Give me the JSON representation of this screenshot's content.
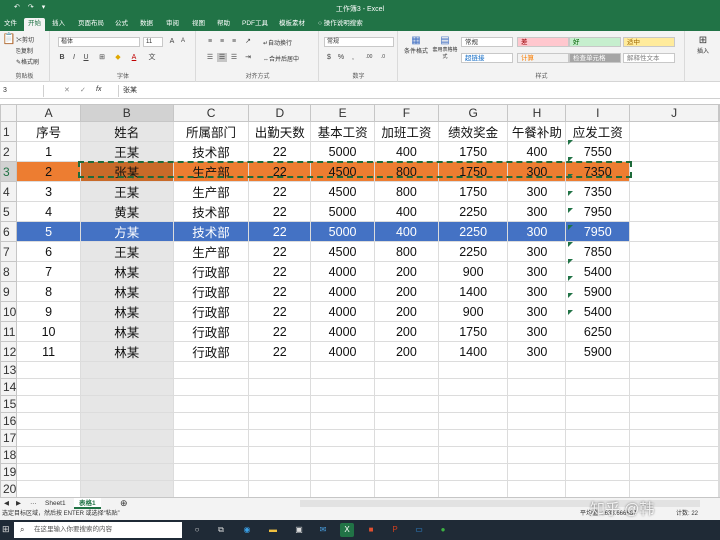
{
  "title_bar": {
    "title": "工作簿3 - Excel",
    "quick_access": [
      "↶",
      "↷",
      "▾"
    ]
  },
  "ribbon_tabs": [
    "文件",
    "开始",
    "插入",
    "页面布局",
    "公式",
    "数据",
    "审阅",
    "视图",
    "帮助",
    "PDF工具",
    "模板素材",
    "操作说明搜索"
  ],
  "active_tab": "开始",
  "ribbon": {
    "clipboard": {
      "cut": "剪切",
      "copy": "复制",
      "format_painter": "格式刷",
      "label": "剪贴板"
    },
    "font": {
      "name": "楷体",
      "size": "11",
      "label": "字体"
    },
    "alignment": {
      "wrap": "自动换行",
      "merge": "合并后居中",
      "label": "对齐方式"
    },
    "number": {
      "format": "常规",
      "label": "数字"
    },
    "styles": {
      "conditional": "条件格式",
      "table_format": "套用表格格式",
      "cells": [
        {
          "text": "常规",
          "bg": "#ffffff",
          "color": "#333333"
        },
        {
          "text": "差",
          "bg": "#ffc7ce",
          "color": "#9c0006"
        },
        {
          "text": "好",
          "bg": "#c6efce",
          "color": "#006100"
        },
        {
          "text": "适中",
          "bg": "#ffeb9c",
          "color": "#9c6500"
        },
        {
          "text": "超链接",
          "bg": "#ffffff",
          "color": "#0563c1"
        },
        {
          "text": "计算",
          "bg": "#f2f2f2",
          "color": "#fa7d00"
        },
        {
          "text": "检查单元格",
          "bg": "#a5a5a5",
          "color": "#ffffff"
        },
        {
          "text": "解释性文本",
          "bg": "#ffffff",
          "color": "#7f7f7f"
        }
      ],
      "label": "样式"
    },
    "insert_label": "插入"
  },
  "formula_bar": {
    "name_box": "3",
    "content": "张某",
    "cancel": "✕",
    "enter": "✓",
    "fx": "fx"
  },
  "columns": [
    "A",
    "B",
    "C",
    "D",
    "E",
    "F",
    "G",
    "H",
    "I",
    "J"
  ],
  "rows": [
    [
      "序号",
      "姓名",
      "所属部门",
      "出勤天数",
      "基本工资",
      "加班工资",
      "绩效奖金",
      "午餐补助",
      "应发工资",
      ""
    ],
    [
      "1",
      "王某",
      "技术部",
      "22",
      "5000",
      "400",
      "1750",
      "400",
      "7550",
      ""
    ],
    [
      "2",
      "张某",
      "生产部",
      "22",
      "4500",
      "800",
      "1750",
      "300",
      "7350",
      ""
    ],
    [
      "3",
      "王某",
      "生产部",
      "22",
      "4500",
      "800",
      "1750",
      "300",
      "7350",
      ""
    ],
    [
      "4",
      "黄某",
      "技术部",
      "22",
      "5000",
      "400",
      "2250",
      "300",
      "7950",
      ""
    ],
    [
      "5",
      "方某",
      "技术部",
      "22",
      "5000",
      "400",
      "2250",
      "300",
      "7950",
      ""
    ],
    [
      "6",
      "王某",
      "生产部",
      "22",
      "4500",
      "800",
      "2250",
      "300",
      "7850",
      ""
    ],
    [
      "7",
      "林某",
      "行政部",
      "22",
      "4000",
      "200",
      "900",
      "300",
      "5400",
      ""
    ],
    [
      "8",
      "林某",
      "行政部",
      "22",
      "4000",
      "200",
      "1400",
      "300",
      "5900",
      ""
    ],
    [
      "9",
      "林某",
      "行政部",
      "22",
      "4000",
      "200",
      "900",
      "300",
      "5400",
      ""
    ],
    [
      "10",
      "林某",
      "行政部",
      "22",
      "4000",
      "200",
      "1750",
      "300",
      "6250",
      ""
    ],
    [
      "11",
      "林某",
      "行政部",
      "22",
      "4000",
      "200",
      "1400",
      "300",
      "5900",
      ""
    ],
    [
      "",
      "",
      "",
      "",
      "",
      "",
      "",
      "",
      "",
      ""
    ],
    [
      "",
      "",
      "",
      "",
      "",
      "",
      "",
      "",
      "",
      ""
    ],
    [
      "",
      "",
      "",
      "",
      "",
      "",
      "",
      "",
      "",
      ""
    ],
    [
      "",
      "",
      "",
      "",
      "",
      "",
      "",
      "",
      "",
      ""
    ],
    [
      "",
      "",
      "",
      "",
      "",
      "",
      "",
      "",
      "",
      ""
    ],
    [
      "",
      "",
      "",
      "",
      "",
      "",
      "",
      "",
      "",
      ""
    ],
    [
      "",
      "",
      "",
      "",
      "",
      "",
      "",
      "",
      "",
      ""
    ],
    [
      "",
      "",
      "",
      "",
      "",
      "",
      "",
      "",
      "",
      ""
    ],
    [
      "",
      "",
      "",
      "",
      "",
      "",
      "",
      "",
      "",
      ""
    ],
    [
      "",
      "",
      "",
      "",
      "",
      "",
      "",
      "",
      "",
      ""
    ],
    [
      "",
      "",
      "",
      "",
      "",
      "",
      "",
      "",
      "",
      ""
    ]
  ],
  "row_numbers": [
    "1",
    "2",
    "3",
    "4",
    "5",
    "6",
    "7",
    "8",
    "9",
    "10",
    "11",
    "12",
    "13",
    "14",
    "15",
    "16",
    "17",
    "18",
    "19",
    "20",
    "21",
    "22",
    "23"
  ],
  "highlights": {
    "orange_row": "3",
    "blue_row": "6",
    "orange": "#ed7d31",
    "blue": "#4472c4"
  },
  "sheet_tabs": [
    "Sheet1",
    "表格1"
  ],
  "active_sheet": "表格1",
  "status_bar": {
    "message": "选定目标区域，然后按 ENTER 或选择“粘贴”",
    "average": "平均值: 1633.666667",
    "count": "计数: 22"
  },
  "taskbar": {
    "search_placeholder": "在这里输入你要搜索的内容"
  },
  "watermark": "知乎 @韩"
}
